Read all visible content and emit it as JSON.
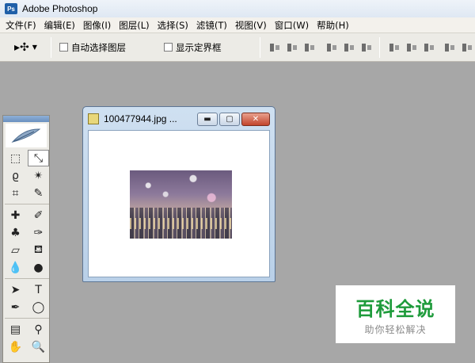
{
  "app": {
    "title": "Adobe Photoshop",
    "icon": "Ps"
  },
  "menu": [
    "文件(F)",
    "编辑(E)",
    "图像(I)",
    "图层(L)",
    "选择(S)",
    "滤镜(T)",
    "视图(V)",
    "窗口(W)",
    "帮助(H)"
  ],
  "options": {
    "tool_icon": "move-tool-icon",
    "auto_select_label": "自动选择图层",
    "auto_select_checked": false,
    "show_bounds_label": "显示定界框",
    "show_bounds_checked": false,
    "align_buttons": [
      "align-top-icon",
      "align-vcenter-icon",
      "align-bottom-icon",
      "align-left-icon",
      "align-hcenter-icon",
      "align-right-icon",
      "distribute-top-icon",
      "distribute-vcenter-icon",
      "distribute-bottom-icon",
      "distribute-left-icon",
      "distribute-hcenter-icon",
      "distribute-right-icon"
    ]
  },
  "toolbox": {
    "tools": [
      [
        "marquee-tool-icon",
        "move-tool-icon"
      ],
      [
        "lasso-tool-icon",
        "magic-wand-tool-icon"
      ],
      [
        "crop-tool-icon",
        "slice-tool-icon"
      ],
      [
        "healing-brush-tool-icon",
        "brush-tool-icon"
      ],
      [
        "clone-stamp-tool-icon",
        "history-brush-tool-icon"
      ],
      [
        "eraser-tool-icon",
        "paint-bucket-tool-icon"
      ],
      [
        "blur-tool-icon",
        "dodge-tool-icon"
      ],
      [
        "path-selection-tool-icon",
        "type-tool-icon"
      ],
      [
        "pen-tool-icon",
        "ellipse-tool-icon"
      ],
      [
        "notes-tool-icon",
        "eyedropper-tool-icon"
      ],
      [
        "hand-tool-icon",
        "zoom-tool-icon"
      ]
    ],
    "glyphs": {
      "marquee-tool-icon": "⬚",
      "move-tool-icon": "⤡",
      "lasso-tool-icon": "ϱ",
      "magic-wand-tool-icon": "✴",
      "crop-tool-icon": "⌗",
      "slice-tool-icon": "✎",
      "healing-brush-tool-icon": "✚",
      "brush-tool-icon": "✐",
      "clone-stamp-tool-icon": "♣",
      "history-brush-tool-icon": "✑",
      "eraser-tool-icon": "▱",
      "paint-bucket-tool-icon": "⛾",
      "blur-tool-icon": "💧",
      "dodge-tool-icon": "●",
      "path-selection-tool-icon": "➤",
      "type-tool-icon": "T",
      "pen-tool-icon": "✒",
      "ellipse-tool-icon": "◯",
      "notes-tool-icon": "▤",
      "eyedropper-tool-icon": "⚲",
      "hand-tool-icon": "✋",
      "zoom-tool-icon": "🔍"
    },
    "selected": "move-tool-icon"
  },
  "document": {
    "title": "100477944.jpg ...",
    "buttons": {
      "minimize": "▬",
      "maximize": "▢",
      "close": "✕"
    }
  },
  "watermark": {
    "main": "百科全说",
    "sub": "助你轻松解决",
    "color": "#1e9b3b"
  }
}
